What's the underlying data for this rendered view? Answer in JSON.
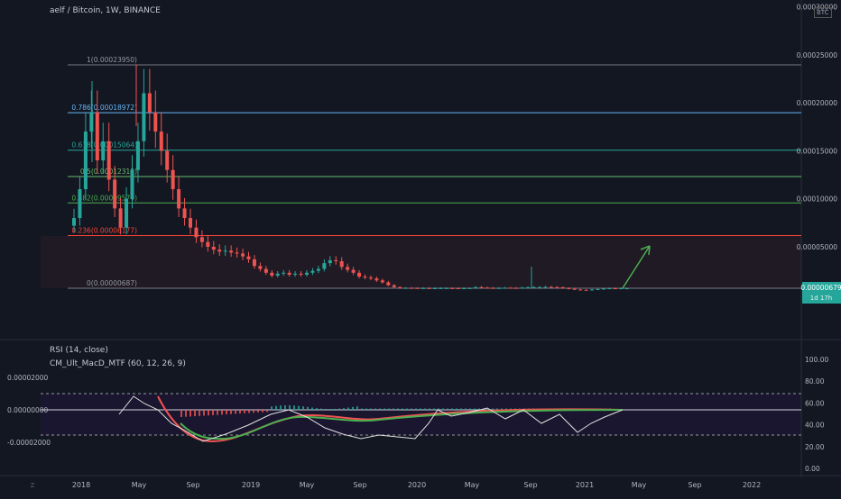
{
  "header": {
    "title": "aelf / Bitcoin, 1W, BINANCE"
  },
  "currency_badge": "BTC",
  "indicators": {
    "rsi": "RSI (14, close)",
    "macd": "CM_Ult_MacD_MTF (60, 12, 26, 9)"
  },
  "price_axis": {
    "ticks": [
      {
        "label": "0.00030000",
        "v": 0.0003
      },
      {
        "label": "0.00025000",
        "v": 0.00025
      },
      {
        "label": "0.00020000",
        "v": 0.0002
      },
      {
        "label": "0.00015000",
        "v": 0.00015
      },
      {
        "label": "0.00010000",
        "v": 0.0001
      },
      {
        "label": "0.00005000",
        "v": 5e-05
      }
    ],
    "current_price": "0.00000679",
    "countdown": "1d 17h"
  },
  "fib_levels": [
    {
      "label": "1(0.00023950)",
      "v": 0.0002395,
      "color": "#787b86"
    },
    {
      "label": "0.786(0.00018972)",
      "v": 0.00018972,
      "color": "#64b5f6"
    },
    {
      "label": "0.618(0.00015064)",
      "v": 0.00015064,
      "color": "#26a69a"
    },
    {
      "label": "0.5(0.00012319)",
      "v": 0.00012319,
      "color": "#66bb6a"
    },
    {
      "label": "0.382(0.00009574)",
      "v": 9.574e-05,
      "color": "#4caf50"
    },
    {
      "label": "0.236(0.00006177)",
      "v": 6.177e-05,
      "color": "#f44336"
    },
    {
      "label": "0(0.00000687)",
      "v": 6.87e-06,
      "color": "#787b86"
    }
  ],
  "rsi_axis": {
    "ticks": [
      {
        "label": "100.00",
        "v": 100
      },
      {
        "label": "80.00",
        "v": 80
      },
      {
        "label": "60.00",
        "v": 60
      },
      {
        "label": "40.00",
        "v": 40
      },
      {
        "label": "20.00",
        "v": 20
      },
      {
        "label": "0.00",
        "v": 0
      }
    ],
    "overbought": 70,
    "oversold": 30
  },
  "macd_axis": {
    "ticks": [
      {
        "label": "0.00002000",
        "v": 2e-05
      },
      {
        "label": "0.00000000",
        "v": 0
      },
      {
        "label": "-0.00002000",
        "v": -2e-05
      }
    ]
  },
  "time_axis": [
    "2018",
    "May",
    "Sep",
    "2019",
    "May",
    "Sep",
    "2020",
    "May",
    "Sep",
    "2021",
    "May",
    "Sep",
    "2022"
  ],
  "chart_data": {
    "type": "candlestick",
    "title": "aelf / Bitcoin, 1W, BINANCE",
    "ylim": [
      0,
      0.00031
    ],
    "weekly_close": [
      8e-05,
      0.00011,
      0.00017,
      0.00019,
      0.00014,
      0.00016,
      0.00012,
      9e-05,
      7e-05,
      0.0001,
      0.00013,
      0.00016,
      0.00021,
      0.00019,
      0.00017,
      0.00015,
      0.00013,
      0.00011,
      9e-05,
      8e-05,
      7e-05,
      6e-05,
      5.5e-05,
      5e-05,
      4.7e-05,
      4.5e-05,
      4.6e-05,
      4.4e-05,
      4.3e-05,
      4e-05,
      3.7e-05,
      3e-05,
      2.7e-05,
      2.3e-05,
      2e-05,
      2.2e-05,
      2.3e-05,
      2.1e-05,
      2.2e-05,
      2.1e-05,
      2.3e-05,
      2.5e-05,
      2.7e-05,
      3.3e-05,
      3.6e-05,
      3.5e-05,
      2.9e-05,
      2.6e-05,
      2.3e-05,
      1.9e-05,
      1.8e-05,
      1.7e-05,
      1.5e-05,
      1.3e-05,
      1e-05,
      8e-06,
      7e-06,
      7.2e-06,
      7.1e-06,
      7e-06,
      7e-06,
      6.8e-06,
      6.9e-06,
      7e-06,
      7e-06,
      6.9e-06,
      6.8e-06,
      6.9e-06,
      7e-06,
      8e-06,
      7.5e-06,
      7.2e-06,
      7e-06,
      7.1e-06,
      7.3e-06,
      7.2e-06,
      7e-06,
      7.5e-06,
      7.8e-06,
      8e-06,
      8e-06,
      8.2e-06,
      8e-06,
      7.8e-06,
      7e-06,
      6.2e-06,
      5.5e-06,
      5.2e-06,
      5e-06,
      5.5e-06,
      6e-06,
      6.5e-06,
      6.8e-06,
      6.7e-06,
      6.8e-06,
      6.8e-06
    ],
    "projection": "rising arrow",
    "fib_retracement": true
  }
}
